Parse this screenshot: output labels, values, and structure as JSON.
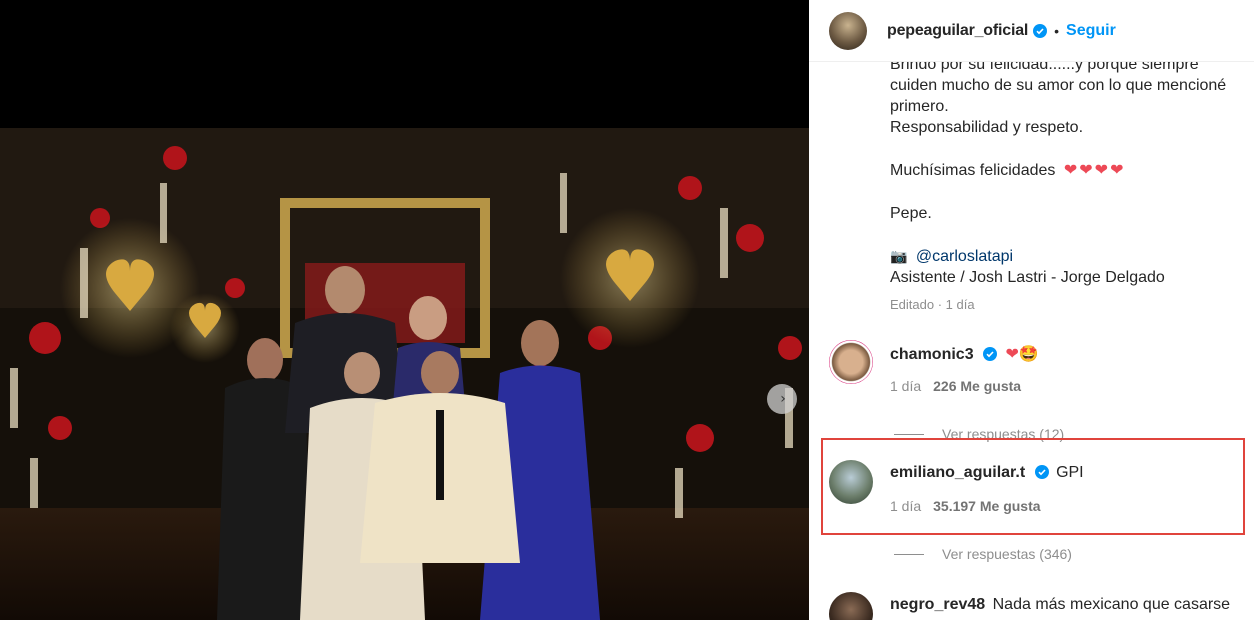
{
  "header": {
    "username": "pepeaguilar_oficial",
    "separator": "•",
    "follow_label": "Seguir"
  },
  "caption": {
    "line_top": "Brindo por su felicidad......y porque siempre",
    "line2": "cuiden mucho de su amor con lo que mencioné",
    "line3": "primero.",
    "line4": "Responsabilidad y respeto.",
    "felicidades": "Muchísimas felicidades",
    "hearts": "❤❤❤❤",
    "sign": "Pepe.",
    "camera": "📷",
    "mention": "@carloslatapi",
    "credits": "Asistente / Josh Lastri - Jorge Delgado",
    "edited": "Editado · 1 día"
  },
  "comments": [
    {
      "username": "chamonic3",
      "text": "❤🤩",
      "time": "1 día",
      "likes": "226 Me gusta",
      "replies": "Ver respuestas (12)"
    },
    {
      "username": "emiliano_aguilar.t",
      "text": "GPI",
      "time": "1 día",
      "likes": "35.197 Me gusta",
      "replies": "Ver respuestas (346)"
    },
    {
      "username": "negro_rev48",
      "text": "Nada más mexicano que casarse"
    }
  ],
  "media": {
    "next_icon": "›"
  },
  "colors": {
    "accent": "#0095f6",
    "highlight": "#e0443c",
    "heart": "#ed4956"
  }
}
